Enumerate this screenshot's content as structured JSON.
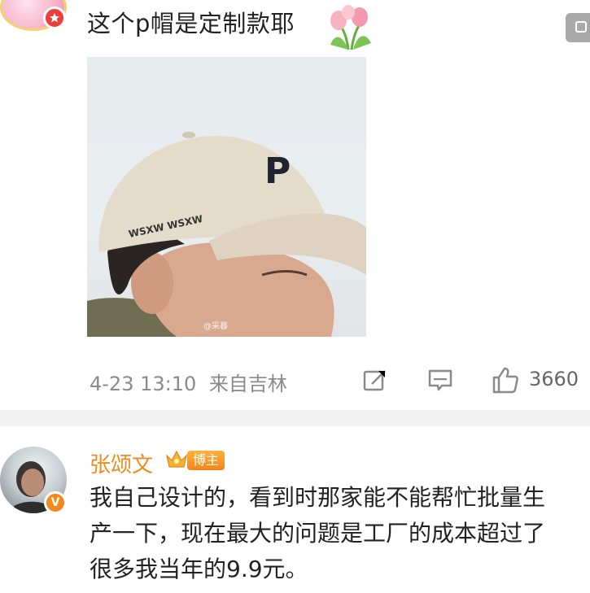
{
  "comment1": {
    "text": "这个p帽是定制款耶",
    "photo_watermark": "@采暮",
    "time": "4-23 13:10",
    "location": "来自吉林",
    "like_count": "3660"
  },
  "comment2": {
    "username": "张颂文",
    "badge": "博主",
    "verified_mark": "V",
    "text": "我自己设计的，看到时那家能不能帮忙批量生产一下，现在最大的问题是工厂的成本超过了很多我当年的9.9元。"
  },
  "colors": {
    "username": "#f08a1d",
    "meta": "#8a8a8a",
    "divider": "#f2f2f2"
  },
  "icons": [
    "tulip-icon",
    "share-edit-icon",
    "comment-icon",
    "like-icon",
    "crown-icon",
    "verified-icon"
  ]
}
